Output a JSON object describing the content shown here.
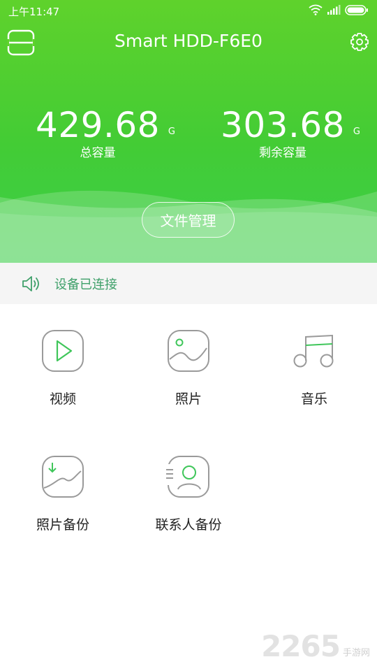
{
  "status_bar": {
    "time": "上午11:47"
  },
  "header": {
    "title": "Smart HDD-F6E0",
    "total": {
      "value": "429.68",
      "unit": "G",
      "label": "总容量"
    },
    "remaining": {
      "value": "303.68",
      "unit": "G",
      "label": "剩余容量"
    },
    "file_button_label": "文件管理"
  },
  "connection": {
    "status_text": "设备已连接"
  },
  "tiles": [
    {
      "label": "视频",
      "icon": "play-icon"
    },
    {
      "label": "照片",
      "icon": "photo-icon"
    },
    {
      "label": "音乐",
      "icon": "music-note-icon"
    },
    {
      "label": "照片备份",
      "icon": "photo-backup-icon"
    },
    {
      "label": "联系人备份",
      "icon": "contact-backup-icon"
    }
  ],
  "watermark": {
    "number": "2265",
    "suffix": "手游网"
  },
  "colors": {
    "accent_green": "#45cc35",
    "icon_gray": "#9a9a9a",
    "play_green": "#3fc65a",
    "connected_green": "#3fa06a"
  }
}
